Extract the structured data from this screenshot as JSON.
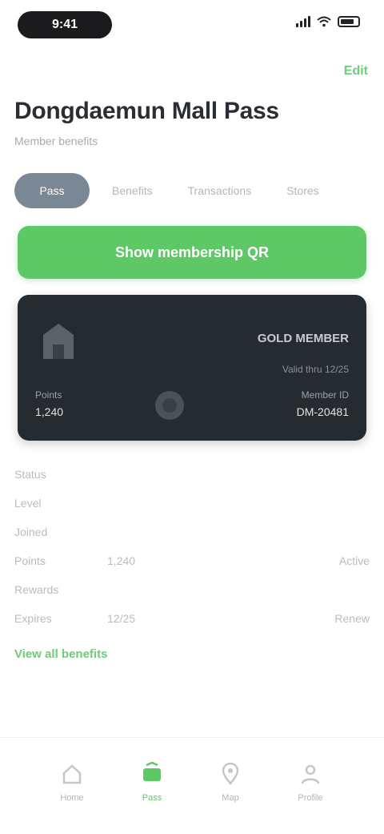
{
  "status_bar": {
    "time": "9:41"
  },
  "header": {
    "action": "Edit",
    "title": "Dongdaemun Mall Pass",
    "subtitle": "Member benefits"
  },
  "chips": [
    {
      "label": "Pass",
      "active": true
    },
    {
      "label": "Benefits",
      "active": false
    },
    {
      "label": "Transactions",
      "active": false
    },
    {
      "label": "Stores",
      "active": false
    }
  ],
  "primary_button": {
    "label": "Show membership QR"
  },
  "card": {
    "tier": "GOLD MEMBER",
    "tier_sub": "Valid thru 12/25",
    "left_label": "Points",
    "left_value": "1,240",
    "right_label": "Member ID",
    "right_value": "DM-20481"
  },
  "info_rows": [
    {
      "label": "Status",
      "middle": "",
      "value": ""
    },
    {
      "label": "Level",
      "middle": "",
      "value": ""
    },
    {
      "label": "Joined",
      "middle": "",
      "value": ""
    },
    {
      "label": "Points",
      "middle": "1,240",
      "value": "Active"
    },
    {
      "label": "Rewards",
      "middle": "",
      "value": ""
    },
    {
      "label": "Expires",
      "middle": "12/25",
      "value": "Renew"
    }
  ],
  "bottom_link": "View all benefits",
  "tabbar": [
    {
      "label": "Home",
      "icon": "home-icon",
      "active": false
    },
    {
      "label": "Pass",
      "icon": "pass-icon",
      "active": true
    },
    {
      "label": "Map",
      "icon": "map-icon",
      "active": false
    },
    {
      "label": "Profile",
      "icon": "profile-icon",
      "active": false
    }
  ],
  "colors": {
    "accent": "#5ec766",
    "card_bg": "#262b30",
    "chip_active": "#7a8795"
  }
}
